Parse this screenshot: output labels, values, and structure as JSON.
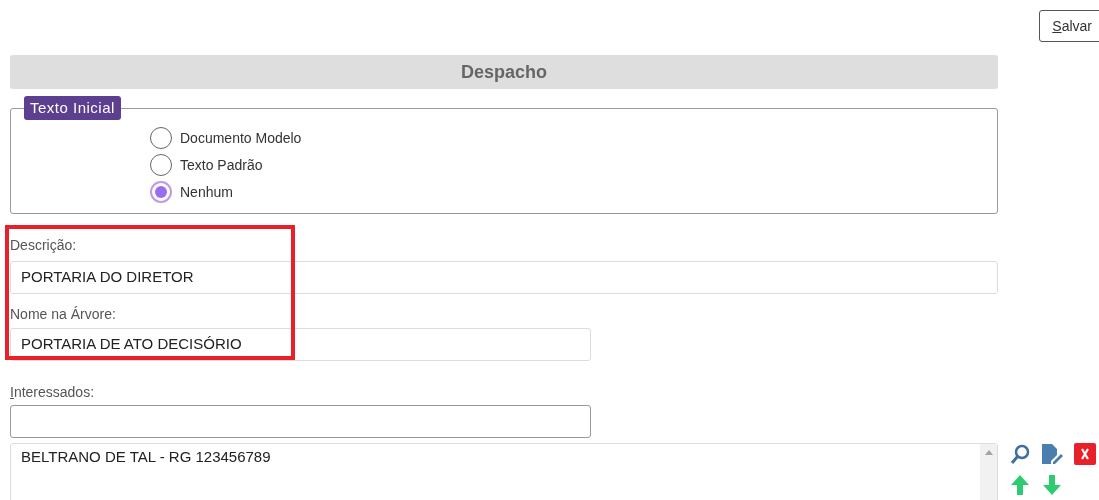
{
  "save_button": {
    "label": "Salvar",
    "underline_first": true
  },
  "header": {
    "title": "Despacho"
  },
  "initial_text": {
    "legend": "Texto Inicial",
    "options": [
      {
        "label": "Documento Modelo",
        "selected": false
      },
      {
        "label": "Texto Padrão",
        "selected": false
      },
      {
        "label": "Nenhum",
        "selected": true
      }
    ]
  },
  "description": {
    "label": "Descrição:",
    "value": "PORTARIA DO DIRETOR"
  },
  "tree_name": {
    "label": "Nome na Árvore:",
    "value": "PORTARIA DE ATO DECISÓRIO"
  },
  "interested": {
    "label": "Interessados:",
    "underline_first": true,
    "items": [
      "BELTRANO DE TAL - RG 123456789"
    ]
  }
}
